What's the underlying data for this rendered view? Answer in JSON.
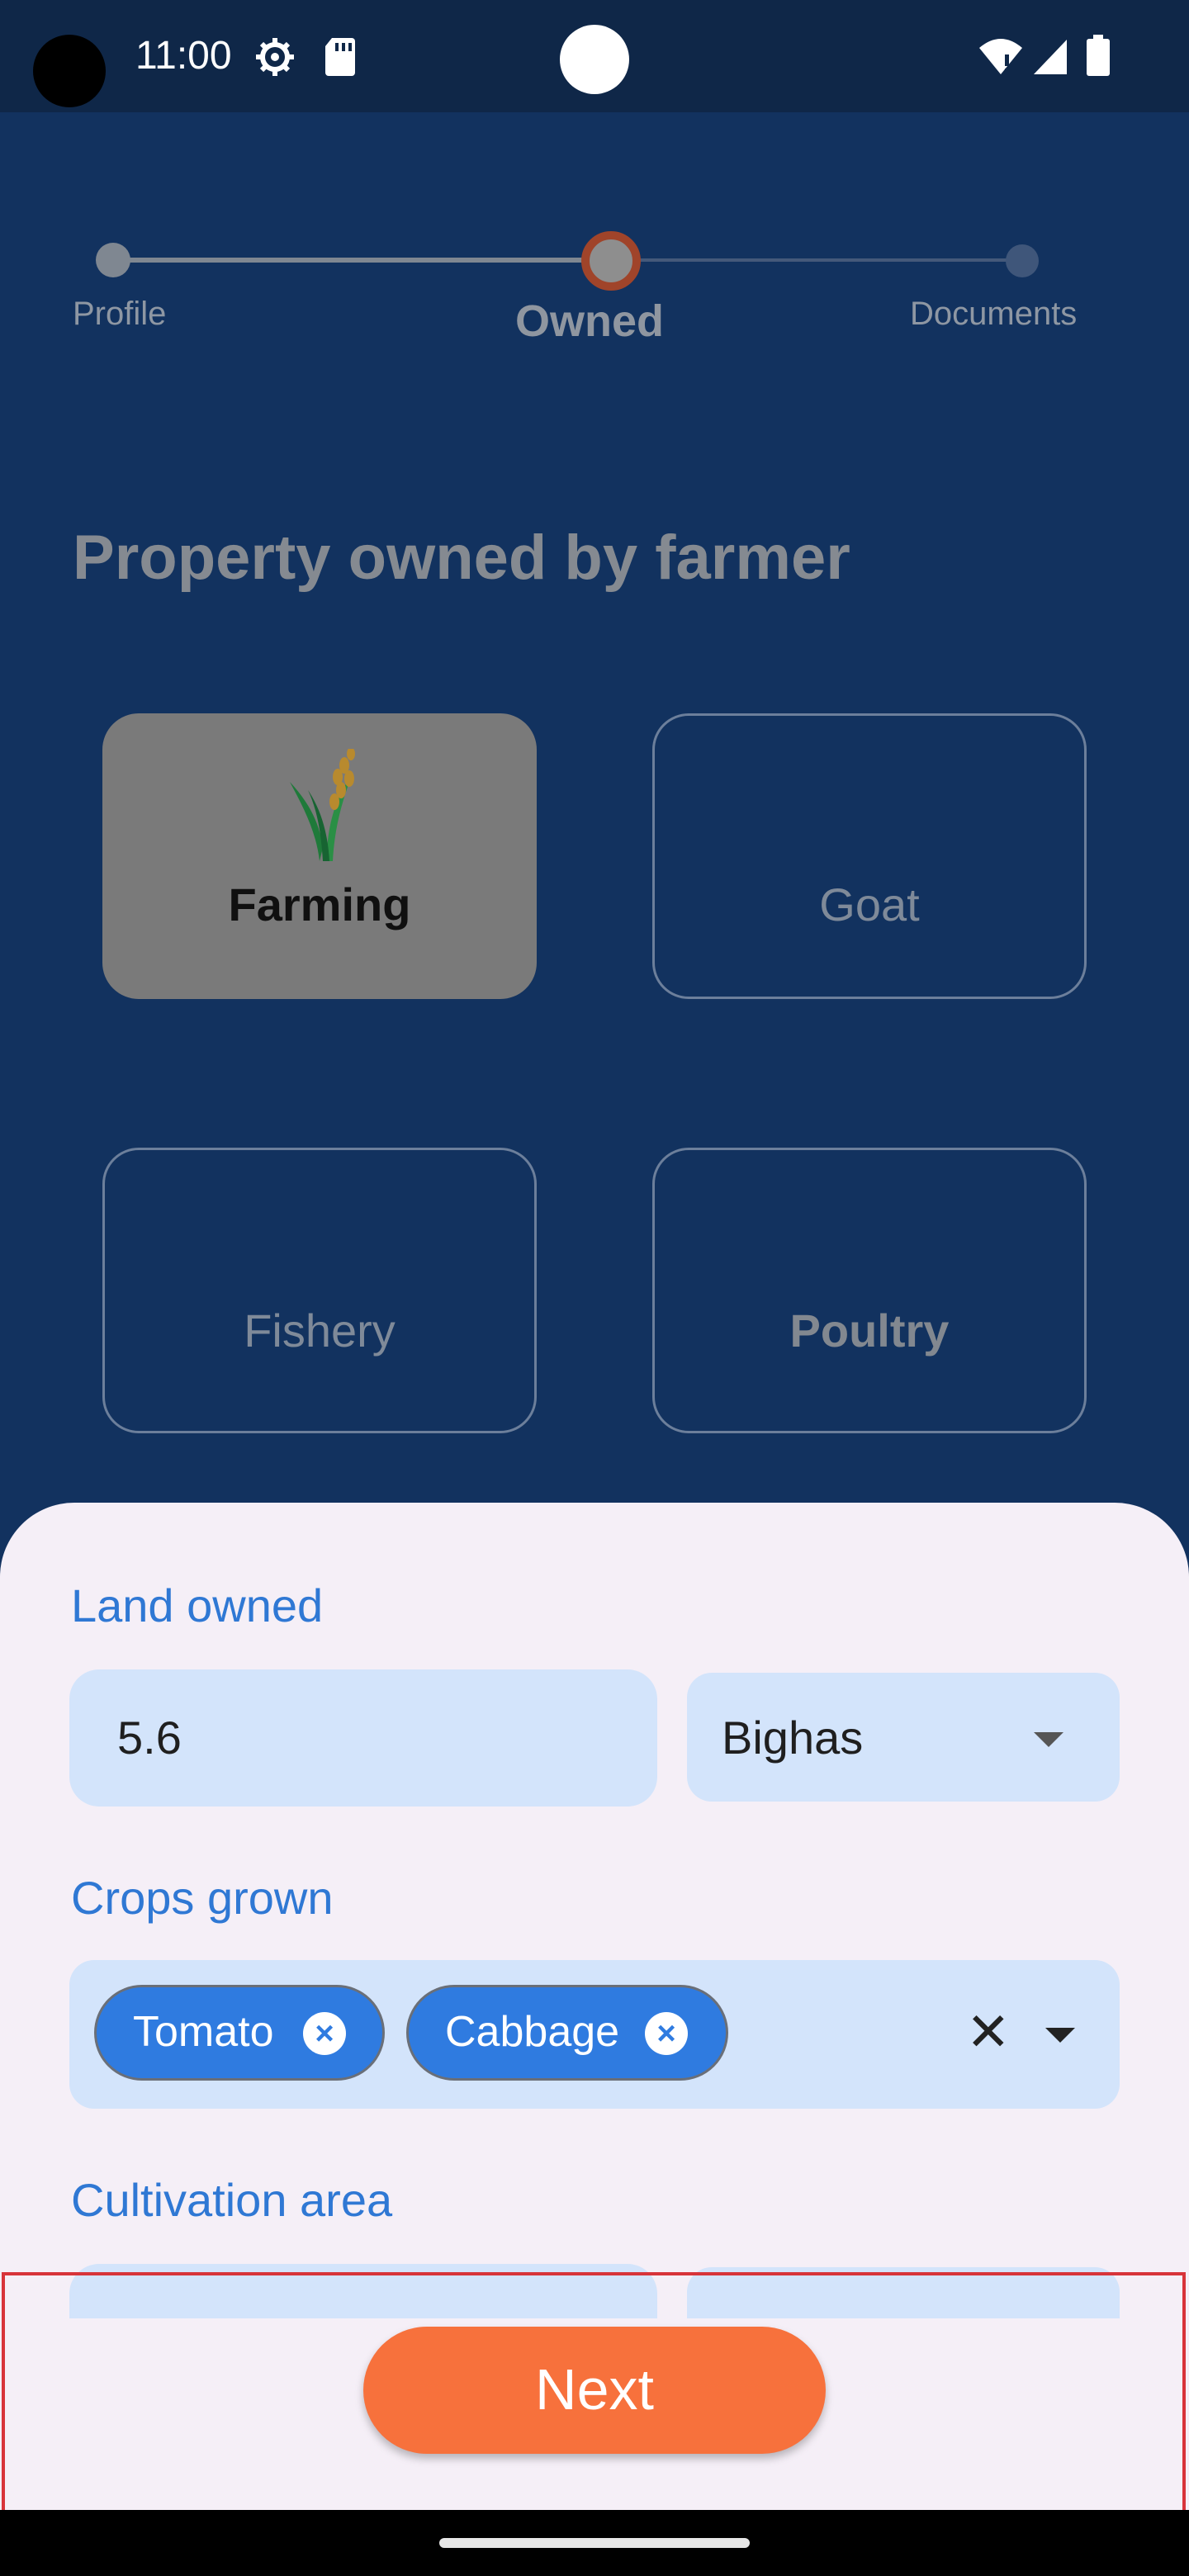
{
  "status_bar": {
    "time": "11:00",
    "icons": [
      "gear-icon",
      "sd-card-icon",
      "wifi-icon",
      "signal-icon",
      "battery-icon"
    ]
  },
  "stepper": {
    "steps": [
      {
        "label": "Profile",
        "state": "completed"
      },
      {
        "label": "Owned",
        "state": "active"
      },
      {
        "label": "Documents",
        "state": "pending"
      }
    ]
  },
  "page": {
    "title": "Property owned by farmer"
  },
  "categories": [
    {
      "label": "Farming",
      "selected": true,
      "icon": "crop-icon"
    },
    {
      "label": "Goat",
      "selected": false
    },
    {
      "label": "Fishery",
      "selected": false
    },
    {
      "label": "Poultry",
      "selected": false
    }
  ],
  "form": {
    "land_owned": {
      "label": "Land owned",
      "value": "5.6",
      "unit": "Bighas"
    },
    "crops_grown": {
      "label": "Crops grown",
      "chips": [
        "Tomato",
        "Cabbage"
      ]
    },
    "cultivation_area": {
      "label": "Cultivation area"
    }
  },
  "actions": {
    "next_label": "Next"
  },
  "colors": {
    "background": "#12325f",
    "sheet": "#f5eff7",
    "accent": "#2f7be0",
    "next_button": "#f7713c",
    "highlight": "#d8343a"
  }
}
